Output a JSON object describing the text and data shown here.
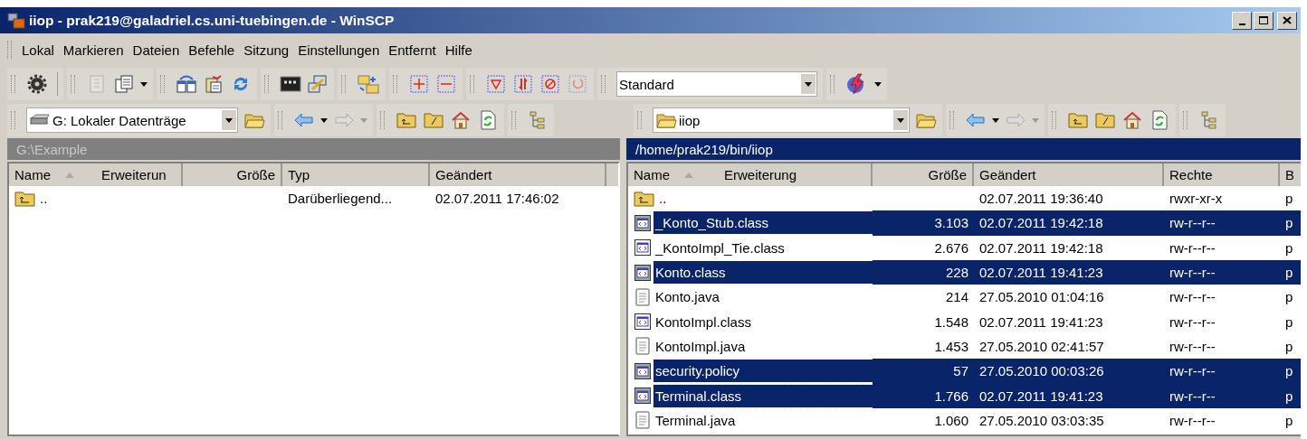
{
  "window": {
    "title": "iiop - prak219@galadriel.cs.uni-tuebingen.de - WinSCP"
  },
  "menu": [
    "Lokal",
    "Markieren",
    "Dateien",
    "Befehle",
    "Sitzung",
    "Einstellungen",
    "Entfernt",
    "Hilfe"
  ],
  "toolbar": {
    "groups": [
      [
        {
          "kind": "gear",
          "disabled": false
        }
      ],
      [
        {
          "kind": "notebook",
          "disabled": true
        },
        {
          "kind": "pages",
          "disabled": false
        },
        {
          "kind": "caret",
          "disabled": false
        }
      ],
      [
        {
          "kind": "compare",
          "disabled": false
        },
        {
          "kind": "clipboard",
          "disabled": false
        },
        {
          "kind": "refresh",
          "disabled": false
        }
      ],
      [
        {
          "kind": "console",
          "disabled": false
        },
        {
          "kind": "key",
          "disabled": false
        }
      ],
      [
        {
          "kind": "swap",
          "disabled": false
        }
      ],
      [
        {
          "kind": "plus",
          "disabled": false
        },
        {
          "kind": "minus",
          "disabled": false
        }
      ],
      [
        {
          "kind": "filter",
          "disabled": false
        },
        {
          "kind": "sync",
          "disabled": false
        },
        {
          "kind": "forbid",
          "disabled": false
        },
        {
          "kind": "undo",
          "disabled": true
        }
      ]
    ],
    "profile": "Standard"
  },
  "local": {
    "location": "G: Lokaler Datenträge",
    "path": "G:\\Example",
    "active": false,
    "columns": [
      "Name",
      "Erweiterun",
      "Größe",
      "Typ",
      "Geändert"
    ],
    "rows": [
      {
        "kind": "parent",
        "name": "..",
        "type": "Darüberliegend...",
        "changed": "02.07.2011  17:46:02"
      }
    ]
  },
  "remote": {
    "location": "iiop",
    "path": "/home/prak219/bin/iiop",
    "active": true,
    "columns": [
      "Name",
      "Erweiterung",
      "Größe",
      "Geändert",
      "Rechte",
      "B"
    ],
    "rows": [
      {
        "kind": "parent",
        "name": "..",
        "size": "",
        "changed": "02.07.2011 19:36:40",
        "rights": "rwxr-xr-x",
        "column_6": "p",
        "selected": false,
        "focused": false
      },
      {
        "kind": "class",
        "name": "_Konto_Stub.class",
        "size": "3.103",
        "changed": "02.07.2011 19:42:18",
        "rights": "rw-r--r--",
        "column_6": "p",
        "selected": true,
        "focused": false
      },
      {
        "kind": "class",
        "name": "_KontoImpl_Tie.class",
        "size": "2.676",
        "changed": "02.07.2011 19:42:18",
        "rights": "rw-r--r--",
        "column_6": "p",
        "selected": false,
        "focused": false
      },
      {
        "kind": "class",
        "name": "Konto.class",
        "size": "228",
        "changed": "02.07.2011 19:41:23",
        "rights": "rw-r--r--",
        "column_6": "p",
        "selected": true,
        "focused": false
      },
      {
        "kind": "text",
        "name": "Konto.java",
        "size": "214",
        "changed": "27.05.2010 01:04:16",
        "rights": "rw-r--r--",
        "column_6": "p",
        "selected": false,
        "focused": false
      },
      {
        "kind": "class",
        "name": "KontoImpl.class",
        "size": "1.548",
        "changed": "02.07.2011 19:41:23",
        "rights": "rw-r--r--",
        "column_6": "p",
        "selected": false,
        "focused": false
      },
      {
        "kind": "text",
        "name": "KontoImpl.java",
        "size": "1.453",
        "changed": "27.05.2010 02:41:57",
        "rights": "rw-r--r--",
        "column_6": "p",
        "selected": false,
        "focused": false
      },
      {
        "kind": "class",
        "name": "security.policy",
        "size": "57",
        "changed": "27.05.2010 00:03:26",
        "rights": "rw-r--r--",
        "column_6": "p",
        "selected": true,
        "focused": false
      },
      {
        "kind": "class",
        "name": "Terminal.class",
        "size": "1.766",
        "changed": "02.07.2011 19:41:23",
        "rights": "rw-r--r--",
        "column_6": "p",
        "selected": true,
        "focused": true
      },
      {
        "kind": "text",
        "name": "Terminal.java",
        "size": "1.060",
        "changed": "27.05.2010 03:03:35",
        "rights": "rw-r--r--",
        "column_6": "p",
        "selected": false,
        "focused": false
      }
    ]
  }
}
